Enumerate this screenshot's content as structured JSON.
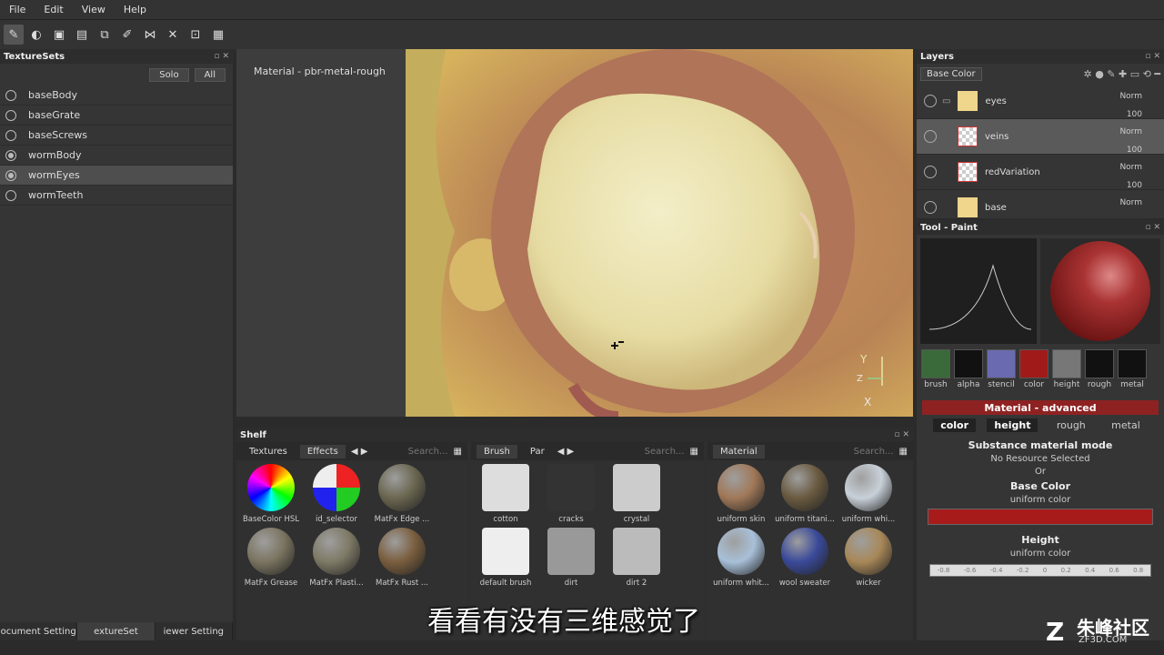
{
  "menu": [
    "File",
    "Edit",
    "View",
    "Help"
  ],
  "texturesets": {
    "title": "TextureSets",
    "solo": "Solo",
    "all": "All",
    "items": [
      {
        "label": "baseBody",
        "selected": false,
        "on": false
      },
      {
        "label": "baseGrate",
        "selected": false,
        "on": false
      },
      {
        "label": "baseScrews",
        "selected": false,
        "on": false
      },
      {
        "label": "wormBody",
        "selected": false,
        "on": true
      },
      {
        "label": "wormEyes",
        "selected": true,
        "on": true
      },
      {
        "label": "wormTeeth",
        "selected": false,
        "on": false
      }
    ],
    "bottom_tabs": [
      "ocument Setting",
      "extureSet",
      "iewer Setting"
    ]
  },
  "viewport": {
    "label": "Material - pbr-metal-rough",
    "axes": {
      "y": "Y",
      "z": "Z",
      "x": "X"
    }
  },
  "shelf": {
    "title": "Shelf",
    "sec1": {
      "tabs": [
        "Textures",
        "Effects"
      ],
      "search": "Search...",
      "items": [
        "BaseColor HSL",
        "id_selector",
        "MatFx Edge ...",
        "MatFx Grease",
        "MatFx Plasti...",
        "MatFx Rust ..."
      ]
    },
    "sec2": {
      "tabs": [
        "Brush",
        "Par"
      ],
      "search": "Search...",
      "items": [
        "cotton",
        "cracks",
        "crystal",
        "default brush",
        "dirt",
        "dirt 2"
      ]
    },
    "sec3": {
      "tabs": [
        "Material"
      ],
      "search": "Search...",
      "items": [
        "uniform skin",
        "uniform titani...",
        "uniform whi...",
        "uniform whit...",
        "wool sweater",
        "wicker"
      ]
    }
  },
  "layers": {
    "title": "Layers",
    "channel": "Base Color",
    "rows": [
      {
        "name": "eyes",
        "blend": "Norm",
        "opacity": "100",
        "thumb": "#f0d58c",
        "folder": true,
        "selected": false
      },
      {
        "name": "veins",
        "blend": "Norm",
        "opacity": "100",
        "thumb": "checker",
        "folder": false,
        "selected": true
      },
      {
        "name": "redVariation",
        "blend": "Norm",
        "opacity": "100",
        "thumb": "checker",
        "folder": false,
        "selected": false
      },
      {
        "name": "base",
        "blend": "Norm",
        "opacity": "",
        "thumb": "#f0d58c",
        "folder": false,
        "selected": false
      }
    ]
  },
  "tool": {
    "title": "Tool - Paint",
    "channels": [
      "brush",
      "alpha",
      "stencil",
      "color",
      "height",
      "rough",
      "metal"
    ],
    "mat_title": "Material - advanced",
    "mat_tabs": [
      "color",
      "height",
      "rough",
      "metal"
    ],
    "mode_title": "Substance material mode",
    "no_res": "No Resource Selected",
    "or": "Or",
    "base_color_title": "Base Color",
    "base_color_sub": "uniform color",
    "height_title": "Height",
    "height_sub": "uniform color",
    "slider_ticks": [
      "-0.8",
      "-0.6",
      "-0.4",
      "-0.2",
      "0",
      "0.2",
      "0.4",
      "0.6",
      "0.8"
    ],
    "base_color": "#a71b1b"
  },
  "subtitle": "看看有没有三维感觉了",
  "watermark": {
    "name": "朱峰社区",
    "url": "ZF3D.COM"
  }
}
